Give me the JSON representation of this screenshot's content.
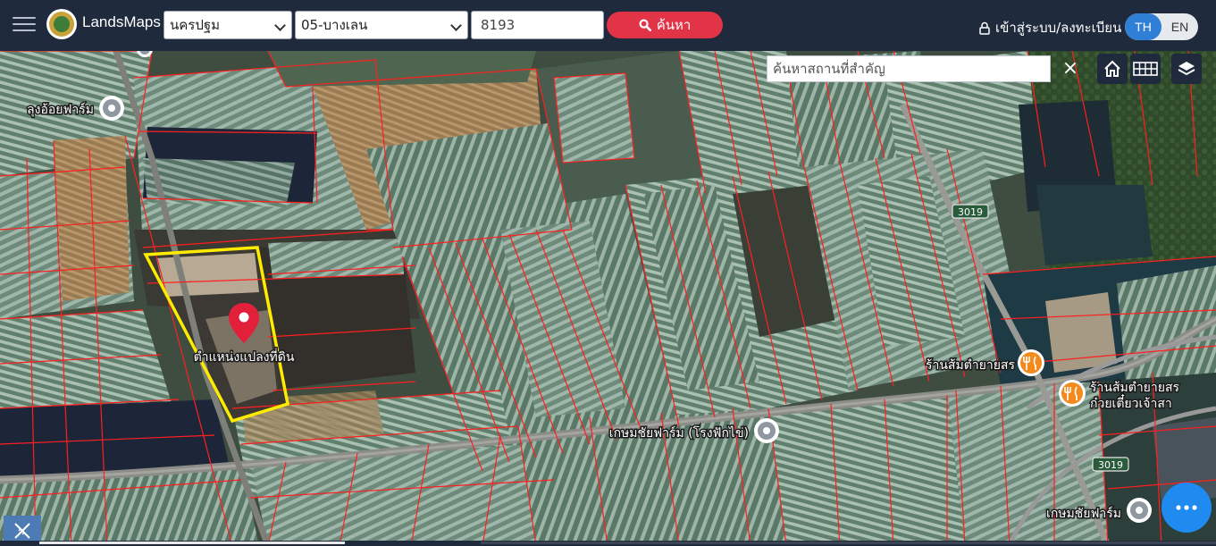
{
  "header": {
    "brand": "LandsMaps",
    "province_select": "นครปฐม",
    "district_select": "05-บางเลน",
    "parcel_input": "8193",
    "search_label": "ค้นหา",
    "login_label": "เข้าสู่ระบบ/ลงทะเบียน",
    "lang_th": "TH",
    "lang_en": "EN"
  },
  "map": {
    "place_search_placeholder": "ค้นหาสถานที่สำคัญ",
    "clear_label": "×",
    "parcel_label": "ตำแหน่งแปลงที่ดิน",
    "road_label_1": "3019",
    "road_label_2": "3019",
    "pois": [
      {
        "label": "ลุงอ้อยฟาร์ม",
        "icon": "location-pin-icon"
      },
      {
        "label": "ร้านส้มตำยายสร",
        "icon": "restaurant-icon"
      },
      {
        "label": "ร้านส้มตำยายสร",
        "icon": "restaurant-icon"
      },
      {
        "label": "ก๋วยเตี๋ยวเจ้าสา",
        "icon": "restaurant-icon"
      },
      {
        "label": "เกษมชัยฟาร์ม",
        "icon": "location-pin-icon"
      },
      {
        "label": "เกษมชัยฟาร์ม (โรงฟักไข่)",
        "icon": "location-pin-icon"
      }
    ]
  },
  "colors": {
    "topbar": "#1f2a3d",
    "search_button": "#e13446",
    "lang_active": "#2f7fd6",
    "parcel_outline": "#ffeb00",
    "boundary": "#ff1f1f",
    "pin": "#e3203a",
    "fab": "#1f8bf0"
  }
}
